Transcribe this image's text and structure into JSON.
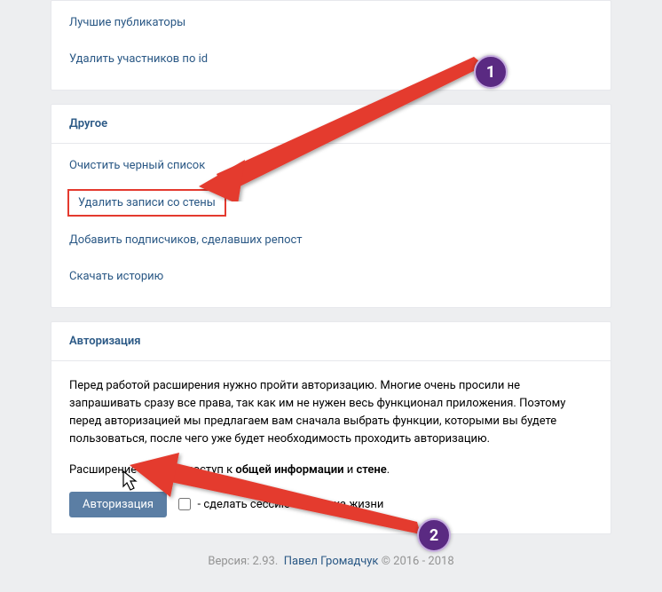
{
  "top_links": [
    "Лучшие публикаторы",
    "Удалить участников по id"
  ],
  "other": {
    "header": "Другое",
    "items": [
      "Очистить черный список",
      "Удалить записи со стены",
      "Добавить подписчиков, сделавших репост",
      "Скачать историю"
    ]
  },
  "auth": {
    "header": "Авторизация",
    "p1_a": "Перед работой расширения нужно пройти авторизацию. Многие очень просили не запрашивать сразу все права, так как им не нужен весь функционал приложения. Поэтому перед авторизацией мы предлагаем вам сначала выбрать функции, которыми вы будете пользоваться, после чего уже будет необходимость проходить авторизацию.",
    "p2_pre": "Расширение получит доступ к ",
    "p2_b1": "общей информации",
    "p2_mid": " и ",
    "p2_b2": "стене",
    "p2_post": ".",
    "button": "Авторизация",
    "checkbox_label": "- сделать сессию без срока жизни"
  },
  "footer": {
    "version_label": "Версия: ",
    "version_val": "2.93.",
    "author": "Павел Громадчук",
    "copyright": " © 2016 - 2018"
  },
  "annotations": {
    "one": "1",
    "two": "2"
  }
}
